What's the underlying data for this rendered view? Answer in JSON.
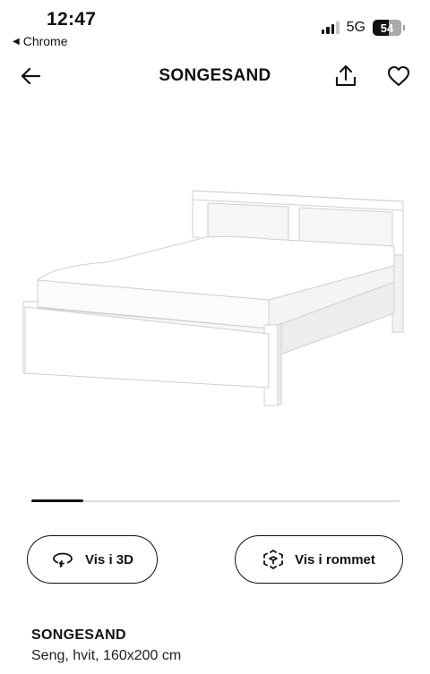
{
  "status_bar": {
    "time": "12:47",
    "back_app": "Chrome",
    "network": "5G",
    "battery": "54"
  },
  "nav": {
    "title": "SONGESAND"
  },
  "image": {
    "alt": "SONGESAND bed frame, white"
  },
  "carousel": {
    "progress": 0.14
  },
  "actions": {
    "view_3d": "Vis i 3D",
    "view_in_room": "Vis i rommet"
  },
  "product": {
    "name": "SONGESAND",
    "description": "Seng, hvit, 160x200 cm"
  },
  "colors": {
    "text": "#111111",
    "background": "#ffffff",
    "track": "#dcdcdc"
  }
}
